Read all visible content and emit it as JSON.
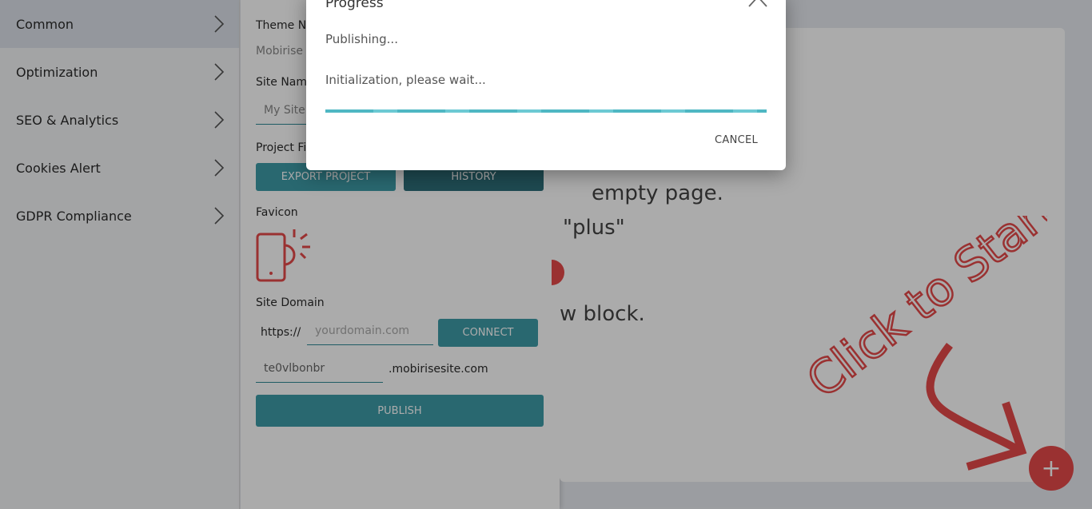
{
  "sidebar": {
    "items": [
      {
        "label": "Common"
      },
      {
        "label": "Optimization"
      },
      {
        "label": "SEO & Analytics"
      },
      {
        "label": "Cookies Alert"
      },
      {
        "label": "GDPR Compliance"
      }
    ]
  },
  "panel": {
    "theme_label": "Theme N",
    "theme_value": "Mobirise",
    "site_name_label": "Site Nam",
    "site_name_value": "My Site",
    "project_files_label": "Project Fi",
    "export_label": "EXPORT PROJECT",
    "history_label": "HISTORY",
    "favicon_label": "Favicon",
    "site_domain_label": "Site Domain",
    "domain_prefix": "https://",
    "domain_placeholder": "yourdomain.com",
    "connect_label": "CONNECT",
    "subdomain_value": "te0vlbonbr",
    "subdomain_suffix": ".mobirisesite.com",
    "publish_label": "PUBLISH"
  },
  "canvas": {
    "line1": "empty page.",
    "line2": "\"plus\"",
    "line3": "w block.",
    "click_to_start": "Click to Start",
    "fab_symbol": "+"
  },
  "modal": {
    "title": "Progress",
    "status": "Publishing...",
    "message": "Initialization, please wait...",
    "progress": 1.0,
    "cancel_label": "CANCEL"
  },
  "colors": {
    "accent": "#3e9ca8",
    "fab": "#e64a4a",
    "progress": "#4fb7c3"
  }
}
